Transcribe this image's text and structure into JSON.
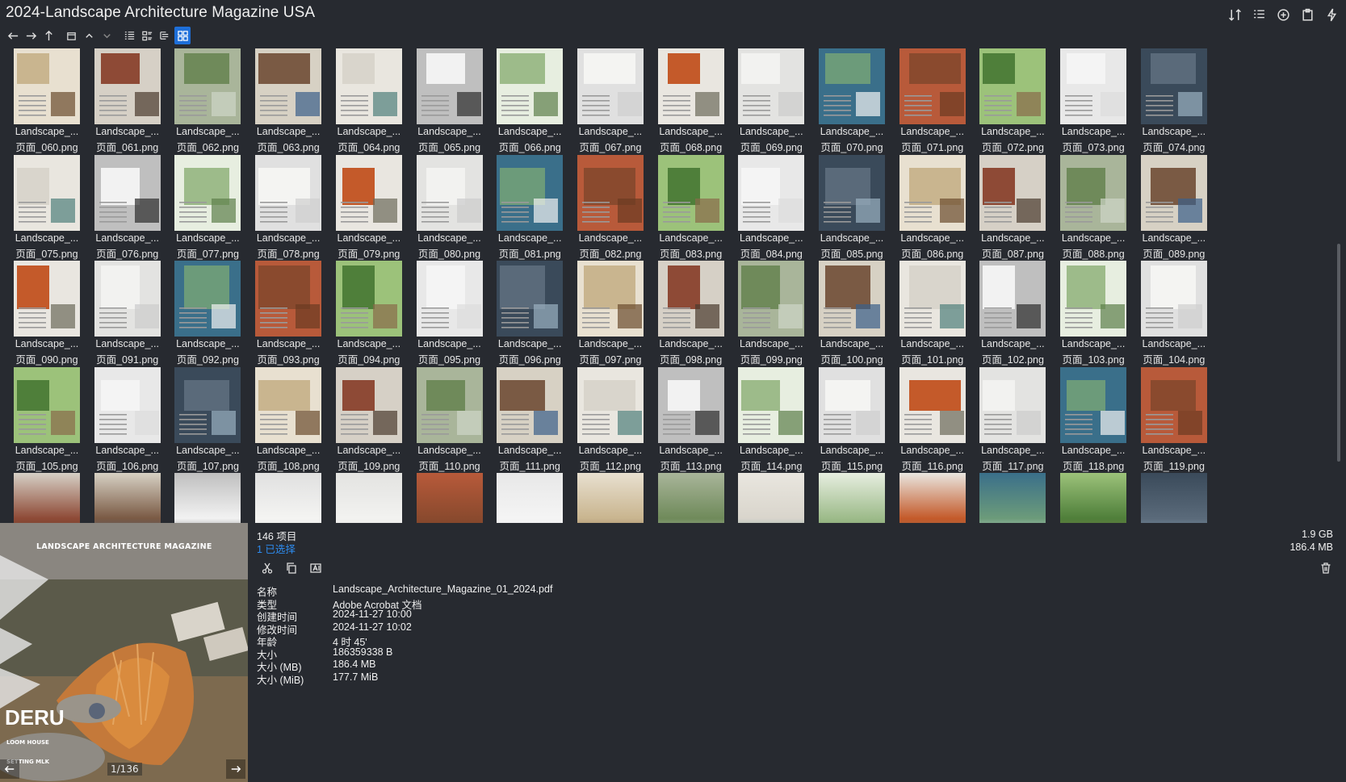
{
  "window": {
    "title": "2024-Landscape Architecture Magazine USA"
  },
  "toolbar": {
    "icons": [
      "arrow-left-icon",
      "arrow-right-icon",
      "arrow-up-icon",
      "window-icon",
      "chevron-up-icon",
      "chevron-down-icon",
      "list-view-icon",
      "details-view-icon",
      "tree-view-icon",
      "grid-view-icon"
    ],
    "right_icons": [
      "sort-icon",
      "list-icon",
      "add-circle-icon",
      "clipboard-icon",
      "flash-icon"
    ]
  },
  "grid": {
    "columns": 15,
    "rows": [
      [
        "060",
        "061",
        "062",
        "063",
        "064",
        "065",
        "066",
        "067",
        "068",
        "069",
        "070",
        "071",
        "072",
        "073",
        "074"
      ],
      [
        "075",
        "076",
        "077",
        "078",
        "079",
        "080",
        "081",
        "082",
        "083",
        "084",
        "085",
        "086",
        "087",
        "088",
        "089"
      ],
      [
        "090",
        "091",
        "092",
        "093",
        "094",
        "095",
        "096",
        "097",
        "098",
        "099",
        "100",
        "101",
        "102",
        "103",
        "104"
      ],
      [
        "105",
        "106",
        "107",
        "108",
        "109",
        "110",
        "111",
        "112",
        "113",
        "114",
        "115",
        "116",
        "117",
        "118",
        "119"
      ]
    ],
    "name_prefix": "Landscape_...",
    "file_prefix": "页面_",
    "file_suffix": ".png"
  },
  "status": {
    "count": "146 项目",
    "selected": "1 已选择",
    "total_size": "1.9 GB",
    "selected_size": "186.4 MB"
  },
  "preview": {
    "page_counter": "1/136",
    "cover_text_magazine": "LANDSCAPE ARCHITECTURE MAGAZINE",
    "cover_text_big": "DERU",
    "cover_text_small1": "LOOM HOUSE",
    "cover_text_small2": "SETTING MLK"
  },
  "properties": [
    {
      "key": "名称",
      "value": "Landscape_Architecture_Magazine_01_2024.pdf"
    },
    {
      "key": "类型",
      "value": "Adobe Acrobat 文档"
    },
    {
      "key": "创建时间",
      "value": "2024-11-27   10:00"
    },
    {
      "key": "修改时间",
      "value": "2024-11-27   10:02"
    },
    {
      "key": "年龄",
      "value": "4 时 45'"
    },
    {
      "key": "大小",
      "value": "186359338 B"
    },
    {
      "key": "大小 (MB)",
      "value": "186.4 MB"
    },
    {
      "key": "大小 (MiB)",
      "value": "177.7 MiB"
    }
  ],
  "colors": {
    "background": "#272a30",
    "accent": "#1e6fd9",
    "selected_text": "#2d8cf0"
  }
}
